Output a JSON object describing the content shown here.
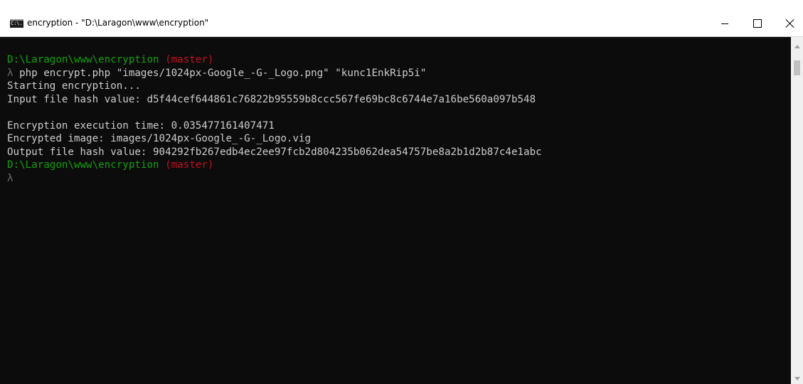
{
  "window": {
    "title": "encryption - \"D:\\Laragon\\www\\encryption\"",
    "icon_name": "cmd-console-icon",
    "icon_text": "C:\\."
  },
  "console": {
    "lines": [
      {
        "segments": [
          {
            "text": "D:\\Laragon\\www\\encryption",
            "color": "green"
          },
          {
            "text": " (master)",
            "color": "red"
          }
        ]
      },
      {
        "segments": [
          {
            "text": "λ",
            "color": "gray"
          },
          {
            "text": " php encrypt.php \"images/1024px-Google_-G-_Logo.png\" \"kunc1EnkRip5i\"",
            "color": "white"
          }
        ]
      },
      {
        "segments": [
          {
            "text": "Starting encryption...",
            "color": "white"
          }
        ]
      },
      {
        "segments": [
          {
            "text": "Input file hash value: d5f44cef644861c76822b95559b8ccc567fe69bc8c6744e7a16be560a097b548",
            "color": "white"
          }
        ]
      },
      {
        "segments": [
          {
            "text": "",
            "color": "white"
          }
        ]
      },
      {
        "segments": [
          {
            "text": "Encryption execution time: 0.035477161407471",
            "color": "white"
          }
        ]
      },
      {
        "segments": [
          {
            "text": "Encrypted image: images/1024px-Google_-G-_Logo.vig",
            "color": "white"
          }
        ]
      },
      {
        "segments": [
          {
            "text": "Output file hash value: 904292fb267edb4ec2ee97fcb2d804235b062dea54757be8a2b1d2b87c4e1abc",
            "color": "white"
          }
        ]
      },
      {
        "segments": [
          {
            "text": "D:\\Laragon\\www\\encryption",
            "color": "green"
          },
          {
            "text": " (master)",
            "color": "red"
          }
        ]
      },
      {
        "segments": [
          {
            "text": "λ",
            "color": "gray"
          }
        ]
      }
    ]
  },
  "colors": {
    "background": "#0c0c0c",
    "text": "#cccccc",
    "green": "#13a10e",
    "red": "#c50f1f"
  },
  "controls": {
    "minimize_icon": "minimize-icon",
    "maximize_icon": "maximize-icon",
    "close_icon": "close-icon"
  }
}
